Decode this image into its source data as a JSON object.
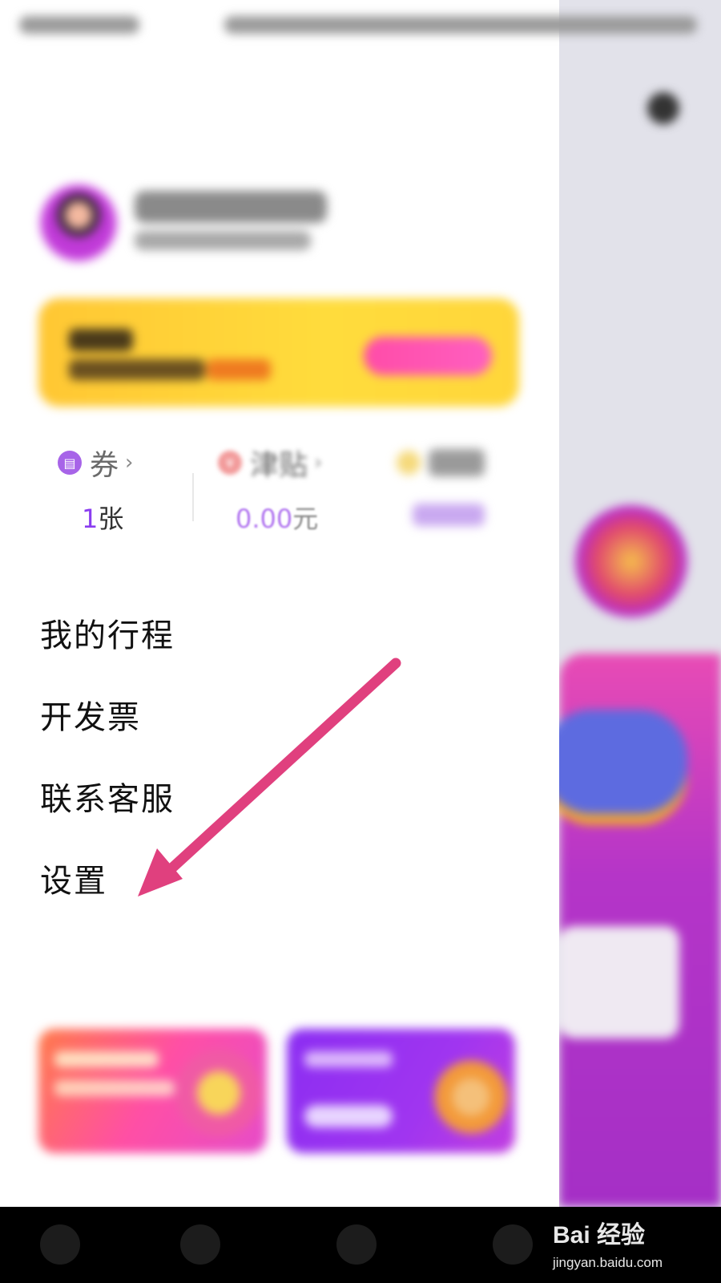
{
  "stats": {
    "coupon": {
      "label": "券",
      "value": "1",
      "unit": "张",
      "icon": "ticket-icon"
    },
    "allowance": {
      "label": "津贴",
      "value": "0.00",
      "unit": "元",
      "icon": "money-bag-icon"
    },
    "third": {
      "icon": "coin-icon"
    }
  },
  "menu": {
    "trips": "我的行程",
    "invoice": "开发票",
    "service": "联系客服",
    "settings": "设置"
  },
  "annotation": {
    "color": "#e0407e",
    "target": "设置"
  },
  "watermark": {
    "brand": "Bai 经验",
    "url": "jingyan.baidu.com"
  },
  "colors": {
    "accent_purple": "#8a3df0",
    "banner_yellow": "#ffd63a",
    "button_pink": "#ff4ca8"
  }
}
